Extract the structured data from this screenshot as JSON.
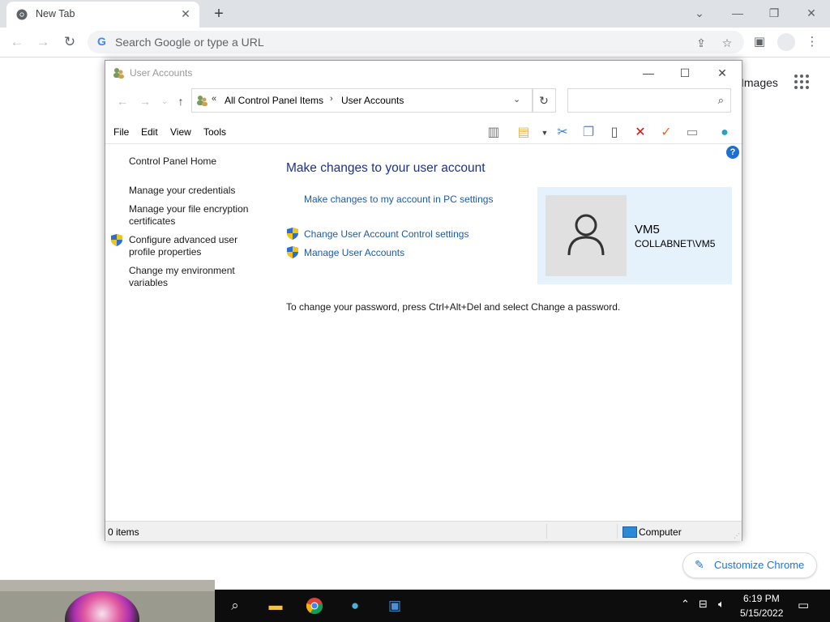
{
  "chrome": {
    "tab_title": "New Tab",
    "tab_close": "✕",
    "new_tab": "+",
    "omnibox_placeholder": "Search Google or type a URL",
    "ntp_images_link": "Images",
    "customize_label": "Customize Chrome",
    "window_controls": {
      "minimize": "—",
      "restore": "❐",
      "close": "✕",
      "tab_search": "⌄"
    },
    "icons": [
      "back-icon",
      "forward-icon",
      "reload-icon",
      "share-icon",
      "bookmark-star-icon",
      "side-panel-icon",
      "profile-icon",
      "menu-icon",
      "apps-grid-icon"
    ]
  },
  "explorer": {
    "title": "User Accounts",
    "breadcrumb": {
      "overflow": "«",
      "items": [
        "All Control Panel Items",
        "User Accounts"
      ]
    },
    "search_placeholder": "",
    "menu": [
      "File",
      "Edit",
      "View",
      "Tools"
    ],
    "left_pane": {
      "home": "Control Panel Home",
      "links": [
        "Manage your credentials",
        "Manage your file encryption certificates",
        "Configure advanced user profile properties",
        "Change my environment variables"
      ]
    },
    "main": {
      "heading": "Make changes to your user account",
      "pc_settings_link": "Make changes to my account in PC settings",
      "uac_link": "Change User Account Control settings",
      "manage_link": "Manage User Accounts",
      "password_note": "To change your password, press Ctrl+Alt+Del and select Change a password."
    },
    "user_tile": {
      "name": "VM5",
      "domain_account": "COLLABNET\\VM5"
    },
    "status_bar": {
      "items": "0 items",
      "location": "Computer"
    },
    "help": "?"
  },
  "taskbar": {
    "time": "6:19 PM",
    "date": "5/15/2022",
    "apps": [
      "search-icon",
      "file-explorer-icon",
      "chrome-icon",
      "network-globe-icon",
      "control-panel-icon"
    ]
  },
  "colors": {
    "link_blue": "#1e5aa8",
    "heading_blue": "#1e3287",
    "tile_bg": "#e5f1fb",
    "chrome_tabstrip": "#dee1e6",
    "customize_blue": "#1a73e8"
  }
}
